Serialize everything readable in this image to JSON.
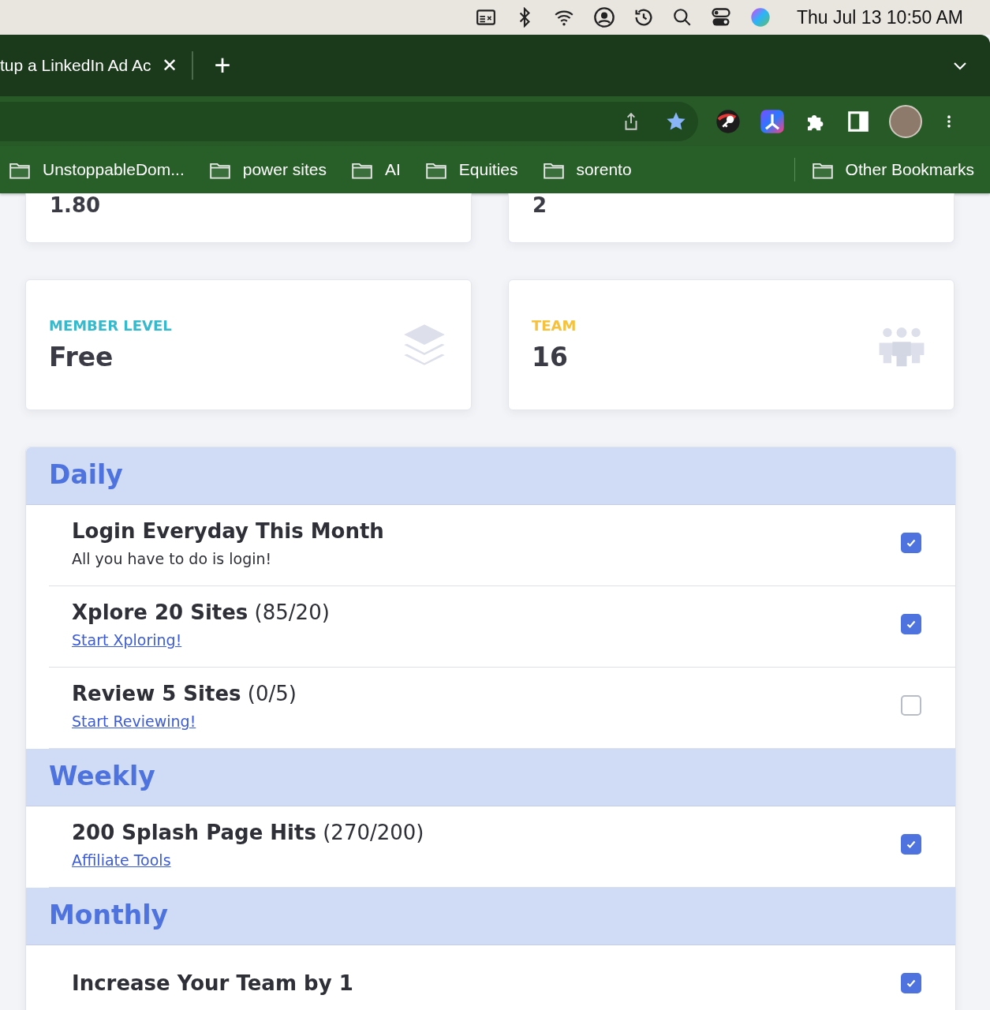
{
  "menu_bar": {
    "clock": "Thu Jul 13  10:50 AM"
  },
  "tab": {
    "title": "tup a LinkedIn Ad Ac",
    "close": "✕"
  },
  "new_tab": "+",
  "bookmarks": [
    {
      "label": "UnstoppableDom..."
    },
    {
      "label": "power sites"
    },
    {
      "label": "AI"
    },
    {
      "label": "Equities"
    },
    {
      "label": "sorento"
    }
  ],
  "other_bookmarks": "Other Bookmarks",
  "top_cards": [
    {
      "value": "1.80"
    },
    {
      "value": "2"
    }
  ],
  "stat_cards": [
    {
      "kind": "layers",
      "label": "MEMBER LEVEL",
      "value": "Free",
      "color": "#36b9cc"
    },
    {
      "kind": "team",
      "label": "TEAM",
      "value": "16",
      "color": "#f6c23e"
    }
  ],
  "sections": [
    {
      "title": "Daily",
      "tasks": [
        {
          "title": "Login Everyday This Month",
          "note": "All you have to do is login!",
          "checked": true
        },
        {
          "title": "Xplore 20 Sites",
          "count": "(85/20)",
          "link": "Start Xploring!",
          "checked": true
        },
        {
          "title": "Review 5 Sites",
          "count": "(0/5)",
          "link": "Start Reviewing!",
          "checked": false
        }
      ]
    },
    {
      "title": "Weekly",
      "tasks": [
        {
          "title": "200 Splash Page Hits",
          "count": "(270/200)",
          "link": "Affiliate Tools",
          "checked": true
        }
      ]
    },
    {
      "title": "Monthly",
      "tasks": [
        {
          "title": "Increase Your Team by 1",
          "checked": true
        }
      ]
    }
  ]
}
